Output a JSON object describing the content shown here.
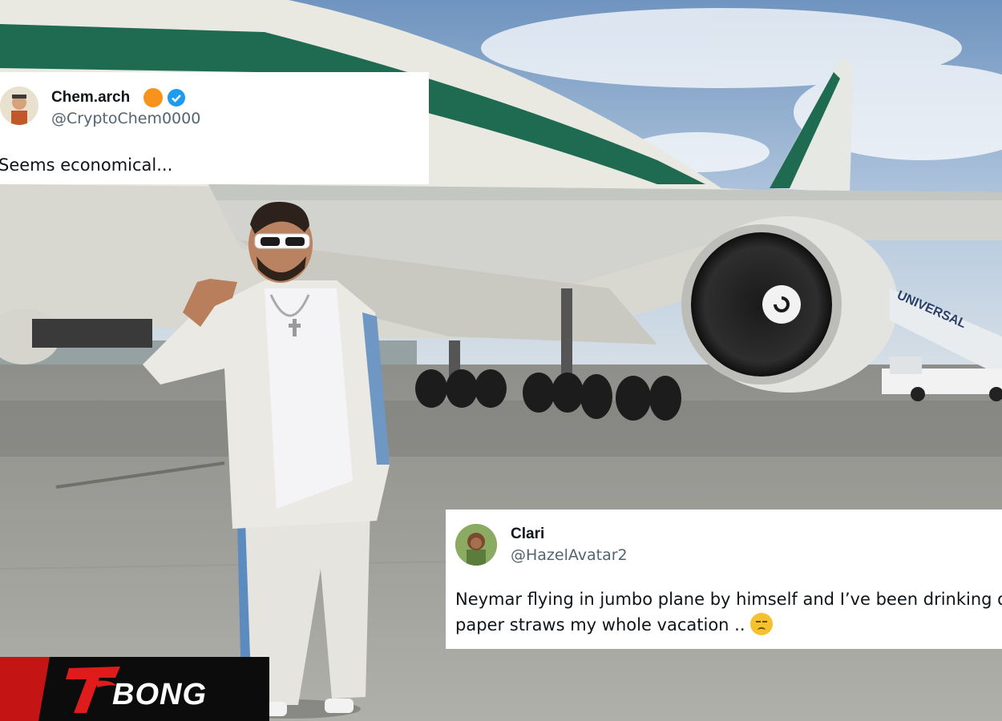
{
  "tweets": [
    {
      "name": "Chem.arch",
      "handle": "@CryptoChem0000",
      "text_lines": [
        "Seems economical..."
      ],
      "badges": [
        "orange-circle-icon",
        "verified-check-icon"
      ]
    },
    {
      "name": "Clari",
      "handle": "@HazelAvatar2",
      "text_lines": [
        "Neymar flying in jumbo plane by himself and I’ve been drinking out",
        "paper straws my whole vacation .."
      ],
      "emoji": "unamused-face-emoji"
    }
  ],
  "plane": {
    "stairs_text": "UNIVERSAL"
  },
  "logo": {
    "mark": "7",
    "text": "BONG"
  },
  "colors": {
    "sky": "#8fb0d0",
    "plane_body": "#e8e8e0",
    "plane_stripe": "#1f6b52",
    "tarmac": "#a3a39f",
    "jacket": "#e6e4de",
    "logo_red": "#c41414",
    "logo_black": "#0c0c0c"
  }
}
